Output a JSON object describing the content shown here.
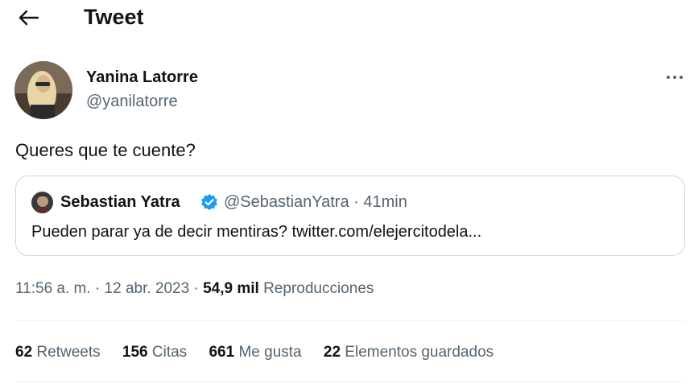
{
  "header": {
    "title": "Tweet",
    "back_icon": "arrow-left-icon"
  },
  "author": {
    "name": "Yanina Latorre",
    "handle": "@yanilatorre",
    "avatar_icon": "avatar"
  },
  "tweet": {
    "text": "Queres que te cuente?"
  },
  "quoted": {
    "name": "Sebastian Yatra",
    "handle_time": "@SebastianYatra · 41min",
    "text": "Pueden parar ya de decir mentiras? twitter.com/elejercitodela...",
    "verified_color": "#1d9bf0"
  },
  "meta": {
    "datetime": "11:56 a. m. · 12 abr. 2023 · ",
    "views_count": "54,9 mil",
    "views_label": " Reproducciones"
  },
  "stats": [
    {
      "num": "62",
      "label": " Retweets"
    },
    {
      "num": "156",
      "label": " Citas"
    },
    {
      "num": "661",
      "label": " Me gusta"
    },
    {
      "num": "22",
      "label": " Elementos guardados"
    }
  ]
}
